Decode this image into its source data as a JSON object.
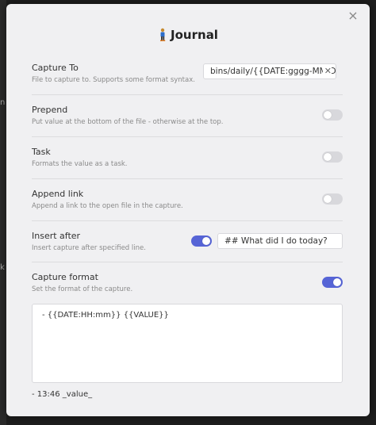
{
  "backdrop": {
    "left_glyph_1": "n",
    "left_glyph_2": "k"
  },
  "modal": {
    "title": "Journal",
    "close_label": "×"
  },
  "settings": [
    {
      "name": "Capture To",
      "desc": "File to capture to. Supports some format syntax.",
      "input_value": "bins/daily/{{DATE:gggg-MM-D",
      "clear_label": "✕"
    },
    {
      "name": "Prepend",
      "desc": "Put value at the bottom of the file - otherwise at the top.",
      "enabled": false
    },
    {
      "name": "Task",
      "desc": "Formats the value as a task.",
      "enabled": false
    },
    {
      "name": "Append link",
      "desc": "Append a link to the open file in the capture.",
      "enabled": false
    },
    {
      "name": "Insert after",
      "desc": "Insert capture after specified line.",
      "enabled": true,
      "input_value": "## What did I do today?"
    },
    {
      "name": "Capture format",
      "desc": "Set the format of the capture.",
      "enabled": true
    }
  ],
  "capture_format": {
    "template": "- {{DATE:HH:mm}} {{VALUE}}",
    "preview": "- 13:46 _value_"
  },
  "colors": {
    "accent": "#5664d6",
    "modal_bg": "#f0f0f2",
    "backdrop": "#1e1e1e"
  },
  "icons": {
    "title_icon": "person-walking-icon",
    "close": "close-icon"
  }
}
